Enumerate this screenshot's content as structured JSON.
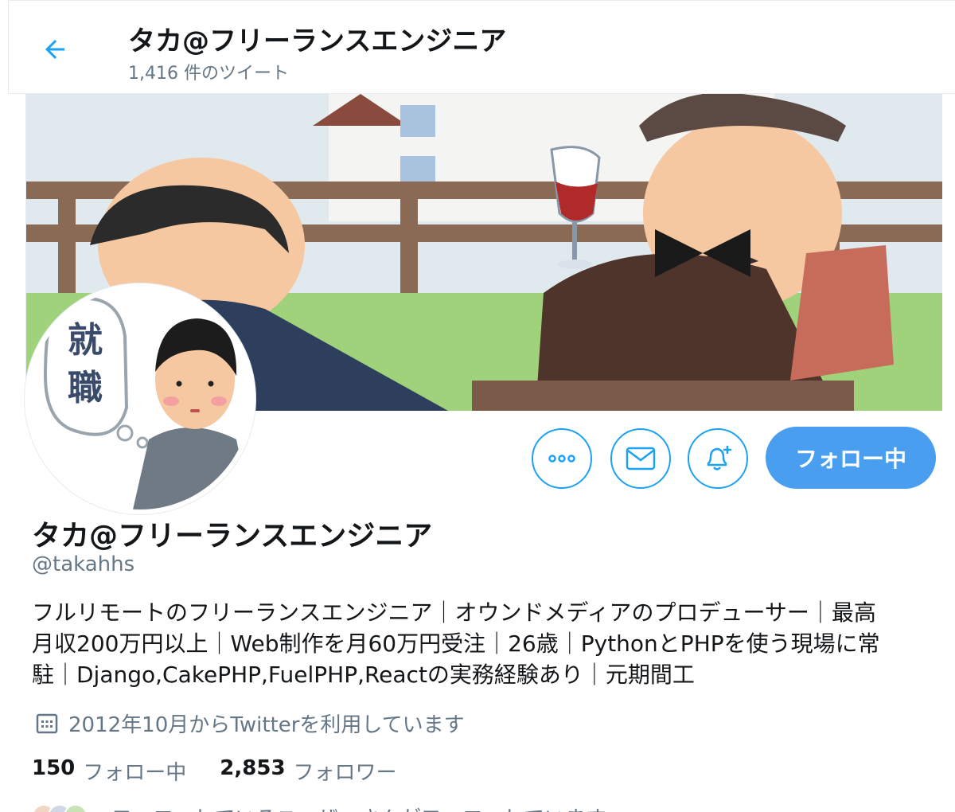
{
  "header": {
    "title": "タカ@フリーランスエンジニア",
    "tweet_count": "1,416 件のツイート"
  },
  "profile": {
    "name": "タカ@フリーランスエンジニア",
    "handle": "@takahhs",
    "bio_lines": [
      "フルリモートのフリーランスエンジニア｜オウンドメディアのプロデューサー｜最高",
      "月収200万円以上｜Web制作を月60万円受注｜26歳｜PythonとPHPを使う現場に常",
      "駐｜Django,CakePHP,FuelPHP,Reactの実務経験あり｜元期間工"
    ],
    "avatar_text": "就職",
    "joined": "2012年10月からTwitterを利用しています"
  },
  "actions": {
    "follow_label": "フォロー中"
  },
  "stats": {
    "following_count": "150",
    "following_label": "フォロー中",
    "followers_count": "2,853",
    "followers_label": "フォロワー"
  },
  "known_followers": {
    "text": "フォローしているユーザーさんがフォローしています"
  },
  "colors": {
    "accent": "#1da1f2",
    "follow_button": "#4a9ef0",
    "secondary_text": "#657786"
  },
  "icons": [
    "back-arrow-icon",
    "more-icon",
    "mail-icon",
    "notification-bell-icon",
    "calendar-icon"
  ]
}
